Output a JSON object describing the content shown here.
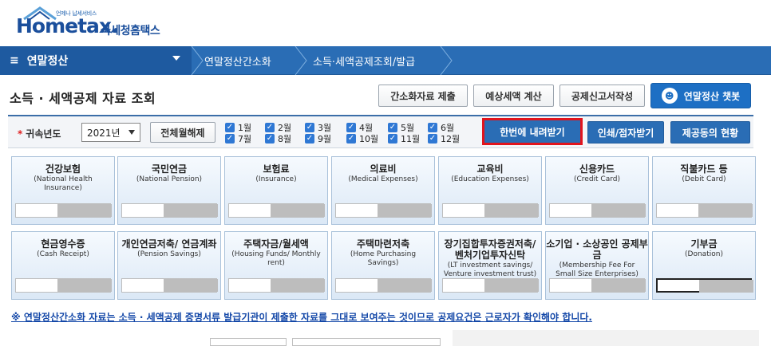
{
  "header": {
    "tagline": "언제나 납세서비스",
    "logo_text": "Hometax.",
    "org_name": "국세청홈택스"
  },
  "nav": {
    "main_label": "연말정산",
    "menu_icon": "≡",
    "crumbs": [
      "연말정산간소화",
      "소득·세액공제조회/발급"
    ]
  },
  "page": {
    "title": "소득 · 세액공제 자료 조회"
  },
  "toolbar": {
    "submit_label": "간소화자료 제출",
    "estimate_label": "예상세액 계산",
    "deduction_label": "공제신고서작성",
    "chatbot_label": "연말정산 챗봇"
  },
  "filter": {
    "year_label": "귀속년도",
    "year_value": "2021년",
    "release_all_label": "전체월해제",
    "months": [
      {
        "label": "1월",
        "checked": true
      },
      {
        "label": "2월",
        "checked": true
      },
      {
        "label": "3월",
        "checked": true
      },
      {
        "label": "4월",
        "checked": true
      },
      {
        "label": "5월",
        "checked": true
      },
      {
        "label": "6월",
        "checked": true
      },
      {
        "label": "7월",
        "checked": true
      },
      {
        "label": "8월",
        "checked": true
      },
      {
        "label": "9월",
        "checked": true
      },
      {
        "label": "10월",
        "checked": true
      },
      {
        "label": "11월",
        "checked": true
      },
      {
        "label": "12월",
        "checked": true
      }
    ],
    "download_all_label": "한번에 내려받기",
    "print_label": "인쇄/점자받기",
    "provider_label": "제공동의 현황"
  },
  "cards": [
    {
      "ko": "건강보험",
      "en": "(National Health Insurance)"
    },
    {
      "ko": "국민연금",
      "en": "(National Pension)"
    },
    {
      "ko": "보험료",
      "en": "(Insurance)"
    },
    {
      "ko": "의료비",
      "en": "(Medical Expenses)"
    },
    {
      "ko": "교육비",
      "en": "(Education Expenses)"
    },
    {
      "ko": "신용카드",
      "en": "(Credit Card)"
    },
    {
      "ko": "직불카드 등",
      "en": "(Debit Card)"
    },
    {
      "ko": "현금영수증",
      "en": "(Cash Receipt)"
    },
    {
      "ko": "개인연금저축/ 연금계좌",
      "en": "(Pension Savings)"
    },
    {
      "ko": "주택자금/월세액",
      "en": "(Housing Funds/ Monthly rent)"
    },
    {
      "ko": "주택마련저축",
      "en": "(Home Purchasing Savings)"
    },
    {
      "ko": "장기집합투자증권저축/ 벤처기업투자신탁",
      "en": "(LT investment savings/ Venture investment trust)"
    },
    {
      "ko": "소기업 · 소상공인 공제부금",
      "en": "(Membership Fee For Small Size Enterprises)"
    },
    {
      "ko": "기부금",
      "en": "(Donation)"
    }
  ],
  "notice": "※ 연말정산간소화 자료는 소득 · 세액공제 증명서류 발급기관이 제출한 자료를 그대로 보여주는 것이므로 공제요건은 근로자가 확인해야 합니다.",
  "colors": {
    "nav_blue": "#2a6db5",
    "nav_dark": "#1e5aa0",
    "highlight_red": "#e1141d",
    "notice_blue": "#1448a8"
  }
}
